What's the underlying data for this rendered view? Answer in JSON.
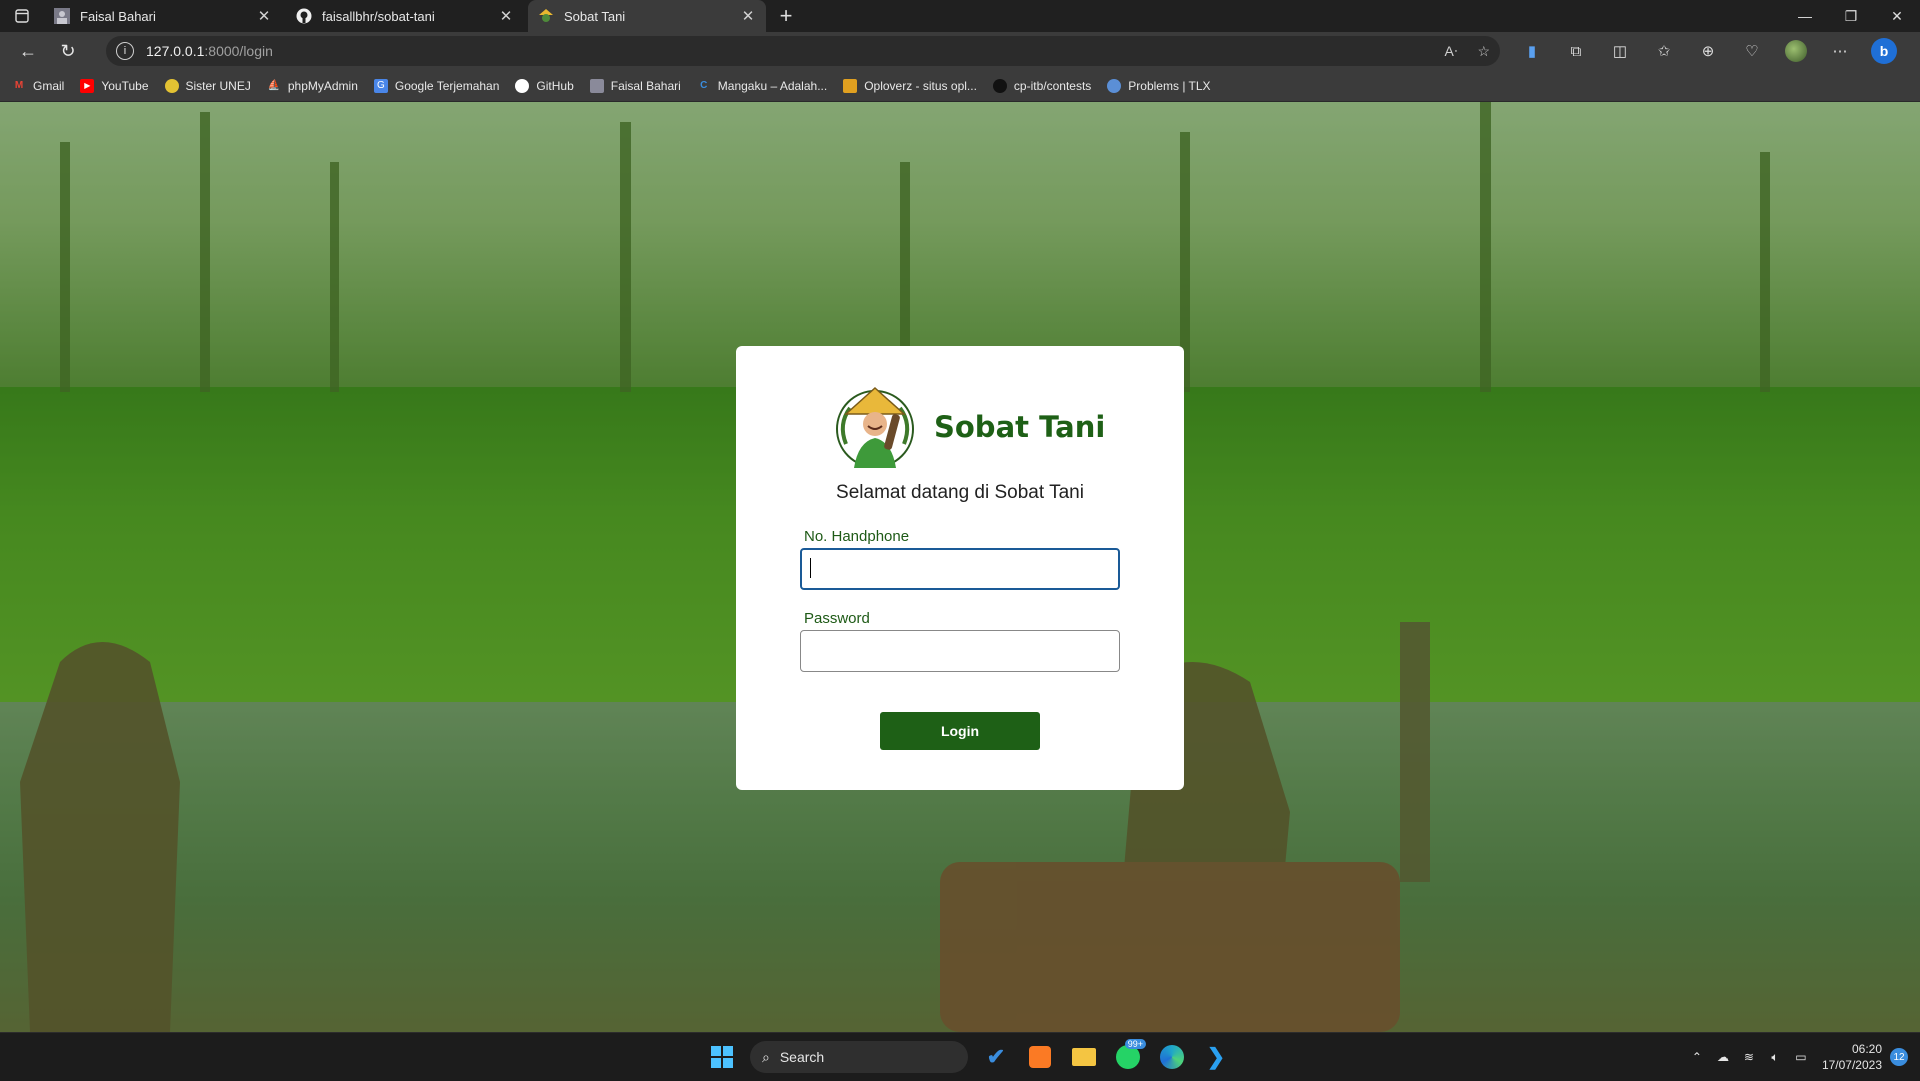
{
  "browser": {
    "tabs": [
      {
        "title": "Faisal Bahari",
        "icon": "profile-icon",
        "active": false
      },
      {
        "title": "faisallbhr/sobat-tani",
        "icon": "github-icon",
        "active": false
      },
      {
        "title": "Sobat Tani",
        "icon": "sobat-tani-icon",
        "active": true
      }
    ],
    "address": {
      "host": "127.0.0.1",
      "path": ":8000/login"
    },
    "bookmarks": [
      {
        "label": "Gmail",
        "icon": "gmail-icon",
        "color": "#ea4335"
      },
      {
        "label": "YouTube",
        "icon": "youtube-icon",
        "color": "#ff0000"
      },
      {
        "label": "Sister UNEJ",
        "icon": "unej-icon",
        "color": "#e3c233"
      },
      {
        "label": "phpMyAdmin",
        "icon": "phpmyadmin-icon",
        "color": "#f29111"
      },
      {
        "label": "Google Terjemahan",
        "icon": "translate-icon",
        "color": "#4a86e8"
      },
      {
        "label": "GitHub",
        "icon": "github-icon",
        "color": "#ffffff"
      },
      {
        "label": "Faisal Bahari",
        "icon": "profile-icon",
        "color": "#8a8a9a"
      },
      {
        "label": "Mangaku – Adalah...",
        "icon": "mangaku-icon",
        "color": "#3a8dde"
      },
      {
        "label": "Oploverz - situs opl...",
        "icon": "oploverz-icon",
        "color": "#e0a020"
      },
      {
        "label": "cp-itb/contests",
        "icon": "cp-itb-icon",
        "color": "#222222"
      },
      {
        "label": "Problems | TLX",
        "icon": "tlx-icon",
        "color": "#5b8fd6"
      }
    ]
  },
  "login": {
    "brand": "Sobat Tani",
    "welcome": "Selamat datang di Sobat Tani",
    "phone_label": "No. Handphone",
    "phone_value": "",
    "password_label": "Password",
    "password_value": "",
    "button": "Login",
    "accent": "#1e6016"
  },
  "taskbar": {
    "search": "Search",
    "whatsapp_badge": "99+",
    "time": "06:20",
    "date": "17/07/2023",
    "notifications": "12"
  }
}
